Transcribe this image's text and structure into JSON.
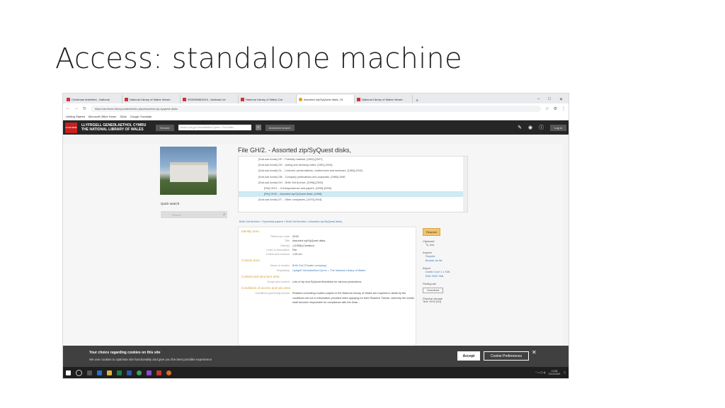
{
  "slide": {
    "title": "Access: standalone machine"
  },
  "browser": {
    "tabs": [
      {
        "label": "Christmas festivities - National"
      },
      {
        "label": "National Library of Wales Viewer"
      },
      {
        "label": "9939398824419 - National Lib"
      },
      {
        "label": "National Library of Wales Cat"
      },
      {
        "label": "Assorted zip/SyQuest disks, 19"
      },
      {
        "label": "National Library of Wales Viewer"
      }
    ],
    "url": "https://archives.library.wales/index.php/assorted-zip-syquest-disks",
    "bookmarks": [
      "Getting Started",
      "Microsoft Office Home",
      "3Dds",
      "Google Translate"
    ]
  },
  "site": {
    "logo": "LLGC NLW",
    "name_cy": "LLYFRGELL GENEDLAETHOL CYMRU",
    "name_en": "THE NATIONAL LIBRARY OF WALES",
    "browse": "Browse",
    "search_placeholder": "Search (at gyd Genedlaethol Cymru > The Natio",
    "advanced": "Advanced search",
    "login": "Log in"
  },
  "sidebar": {
    "quick_search_label": "Quick search",
    "quick_search_placeholder": "Search"
  },
  "record": {
    "title": "File GH/2. - Assorted zip/SyQuest disks,",
    "tree": [
      "[Sub-sub-fonds] GP. - Publicity material, [1982]-[1997]",
      "[Sub-sub-fonds] GD. - Acting and devising notes, [1981]-2004]",
      "[Sub-sub-fonds] GL. - Lectures, presentations, conferences and seminars, [1984]-2002]",
      "[Sub-sub-fonds] GB. - Company publications and proposals, [1988]-1996",
      "[Sub-sub-fonds] GH. - Brith Gof Archive, [1996]-[2000]",
      "[File] GH/1. - Correspondence and papers, [1999]-[2000]",
      "[File] GH/2. - Assorted zip/SyQuest disks, [1998]",
      "[Sub-sub-fonds] GT. - Other companies, [1979]-2004]"
    ],
    "breadcrumb": "Brith Gof Archive  »  Gymeriad papers  »  Brith Gof Archive  »  Assorted zip/SyQuest disks,",
    "sections": {
      "identity": "Identity area",
      "context": "Context area",
      "content": "Content and structure area",
      "conditions": "Conditions of access and use area"
    },
    "identity": [
      {
        "k": "Reference code",
        "v": "GH/2"
      },
      {
        "k": "Title",
        "v": "Assorted zip/SyQuest disks,"
      },
      {
        "k": "Date(s)",
        "v": "• [1998] (Creation)"
      },
      {
        "k": "Level of description",
        "v": "File"
      },
      {
        "k": "Extent and medium",
        "v": "1.25 cm"
      }
    ],
    "context": [
      {
        "k": "Name of creator",
        "v": "Brith Gof (Theatre company)"
      },
      {
        "k": "Repository",
        "v": "Llyfrgell Genedlaethol Cymru = The National Library of Wales"
      }
    ],
    "content": [
      {
        "k": "Scope and content",
        "v": "Lots of zip and SyQuest files/disks for various productions."
      }
    ],
    "conditions": [
      {
        "k": "Conditions governing access",
        "v": "Readers consulting modern papers in the National Library of Wales are required to abide by the conditions set out in information provided when applying for their Readers' Tickets, whereby the reader shall become responsible for compliance with the Data ..."
      }
    ]
  },
  "actions": {
    "request": "Request",
    "clipboard": "Clipboard",
    "add": "Add",
    "explore": "Explore",
    "reports": "Reports",
    "browse_as_list": "Browse as list",
    "export": "Export",
    "dublin_core": "Dublin Core 1.1 XML",
    "ead": "EAD 2002 XML",
    "finding_aid": "Finding aid",
    "download": "Download",
    "physical_storage": "Physical storage",
    "storage_value": "Text: GH/2 (NJ)"
  },
  "cookie": {
    "title": "Your choice regarding cookies on this site",
    "text": "We use cookies to optimise site functionality and give you the best possible experience",
    "accept": "Accept",
    "preferences": "Cookie Preferences",
    "close": "✕"
  },
  "taskbar": {
    "time": "13:35",
    "date": "11/12/2021"
  }
}
